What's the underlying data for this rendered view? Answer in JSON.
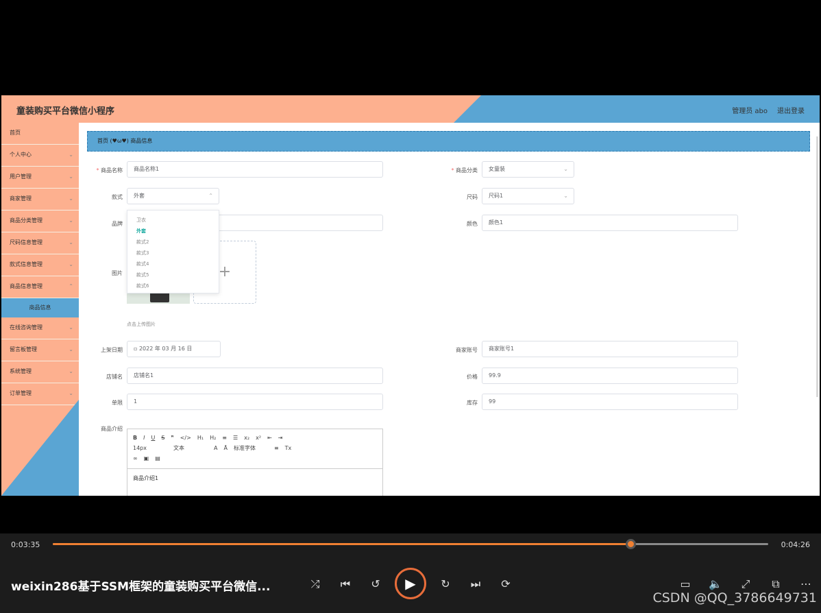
{
  "app": {
    "title": "童装购买平台微信小程序",
    "admin": "管理员 abo",
    "logout": "退出登录"
  },
  "sidebar": {
    "items": [
      {
        "label": "首页"
      },
      {
        "label": "个人中心"
      },
      {
        "label": "用户管理"
      },
      {
        "label": "商家管理"
      },
      {
        "label": "商品分类管理"
      },
      {
        "label": "尺码信息管理"
      },
      {
        "label": "款式信息管理"
      },
      {
        "label": "商品信息管理"
      }
    ],
    "sub_item": "商品信息",
    "items2": [
      {
        "label": "在线咨询管理"
      },
      {
        "label": "留言板管理"
      },
      {
        "label": "系统管理"
      },
      {
        "label": "订单管理"
      }
    ]
  },
  "breadcrumb": {
    "home": "首页",
    "face": "(♥ω♥)",
    "current": "商品信息"
  },
  "form": {
    "name_label": "商品名称",
    "name_value": "商品名称1",
    "category_label": "商品分类",
    "category_value": "女童装",
    "style_label": "款式",
    "style_value": "外套",
    "size_label": "尺码",
    "size_value": "尺码1",
    "brand_label": "品牌",
    "color_label": "颜色",
    "color_value": "颜色1",
    "image_label": "图片",
    "upload_tip": "点击上传图片",
    "date_label": "上架日期",
    "date_value": "2022 年 03 月 16 日",
    "merchant_label": "商家账号",
    "merchant_value": "商家账号1",
    "shop_label": "店铺名",
    "shop_value": "店铺名1",
    "price_label": "价格",
    "price_value": "99.9",
    "limit_label": "单限",
    "limit_value": "1",
    "stock_label": "库存",
    "stock_value": "99",
    "intro_label": "商品介绍",
    "intro_value": "商品介绍1"
  },
  "dropdown": {
    "options": [
      "卫衣",
      "外套",
      "款式2",
      "款式3",
      "款式4",
      "款式5",
      "款式6"
    ],
    "selected": "外套"
  },
  "editor": {
    "font_size": "14px",
    "block_type": "文本",
    "font_family": "标准字体"
  },
  "player": {
    "current_time": "0:03:35",
    "total_time": "0:04:26",
    "progress": 0.807,
    "title": "weixin286基于SSM框架的童装购买平台微信...",
    "watermark": "CSDN @QQ_3786649731",
    "accent": "#f08032"
  }
}
